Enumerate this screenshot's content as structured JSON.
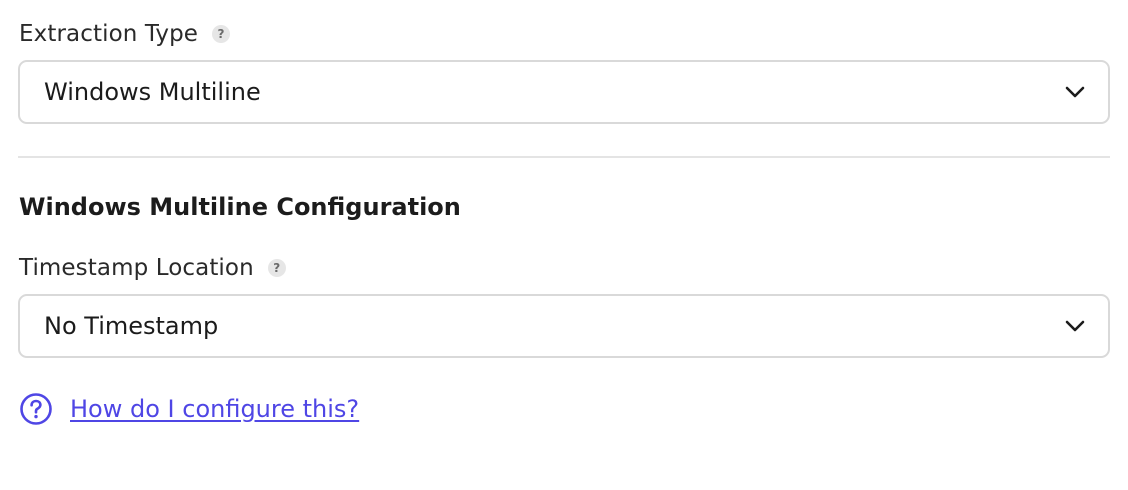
{
  "extraction_type": {
    "label": "Extraction Type",
    "help_glyph": "?",
    "value": "Windows Multiline",
    "icon": "chevron-down-icon"
  },
  "configuration": {
    "title": "Windows Multiline Configuration",
    "timestamp_location": {
      "label": "Timestamp Location",
      "help_glyph": "?",
      "value": "No Timestamp",
      "icon": "chevron-down-icon"
    }
  },
  "help_link": {
    "text": "How do I configure this?",
    "icon": "question-circle-icon",
    "color": "#4f46e5"
  }
}
